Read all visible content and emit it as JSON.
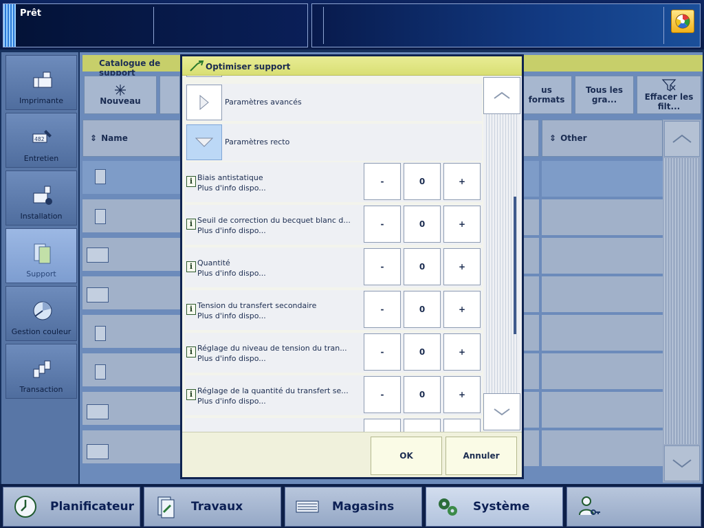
{
  "status": {
    "text": "Prêt"
  },
  "leftnav": {
    "items": [
      {
        "label": "Imprimante",
        "icon": "printer-icon"
      },
      {
        "label": "Entretien",
        "icon": "maintenance-icon"
      },
      {
        "label": "Installation",
        "icon": "installation-icon"
      },
      {
        "label": "Support",
        "icon": "media-icon",
        "active": true
      },
      {
        "label": "Gestion couleur",
        "icon": "color-management-icon"
      },
      {
        "label": "Transaction",
        "icon": "transaction-icon"
      }
    ]
  },
  "catalog": {
    "title": "Catalogue de support",
    "toolbar": {
      "new_label": "Nouveau",
      "all_formats": "us formats",
      "all_weights": "Tous les gra...",
      "clear_filters": "Effacer les filt..."
    },
    "columns": {
      "name": "Name",
      "other": "Other"
    }
  },
  "dialog": {
    "title": "Optimiser support",
    "sections": [
      {
        "label": "Paramètres avancés",
        "expanded": false
      },
      {
        "label": "Paramètres recto",
        "expanded": true
      }
    ],
    "params": [
      {
        "name": "Biais antistatique",
        "sub": "Plus d'info dispo...",
        "value": "0"
      },
      {
        "name": "Seuil de correction du becquet blanc d...",
        "sub": "Plus d'info dispo...",
        "value": "0"
      },
      {
        "name": "Quantité",
        "sub": "Plus d'info dispo...",
        "value": "0"
      },
      {
        "name": "Tension du transfert secondaire",
        "sub": "Plus d'info dispo...",
        "value": "0"
      },
      {
        "name": "Réglage du niveau de tension du tran...",
        "sub": "Plus d'info dispo...",
        "value": "0"
      },
      {
        "name": "Réglage de la quantité du transfert se...",
        "sub": "Plus d'info dispo...",
        "value": "0"
      }
    ],
    "minus_label": "-",
    "plus_label": "+",
    "ok_label": "OK",
    "cancel_label": "Annuler"
  },
  "bottomnav": {
    "items": [
      {
        "label": "Planificateur",
        "icon": "clock-icon"
      },
      {
        "label": "Travaux",
        "icon": "jobs-icon"
      },
      {
        "label": "Magasins",
        "icon": "trays-icon"
      },
      {
        "label": "Système",
        "icon": "gears-icon",
        "active": true
      },
      {
        "label": "",
        "icon": "user-key-icon"
      }
    ]
  },
  "colors": {
    "accent_yellow": "#d9df74",
    "selected_blue": "#bcd8f6",
    "nav_dark": "#0d1f48"
  }
}
